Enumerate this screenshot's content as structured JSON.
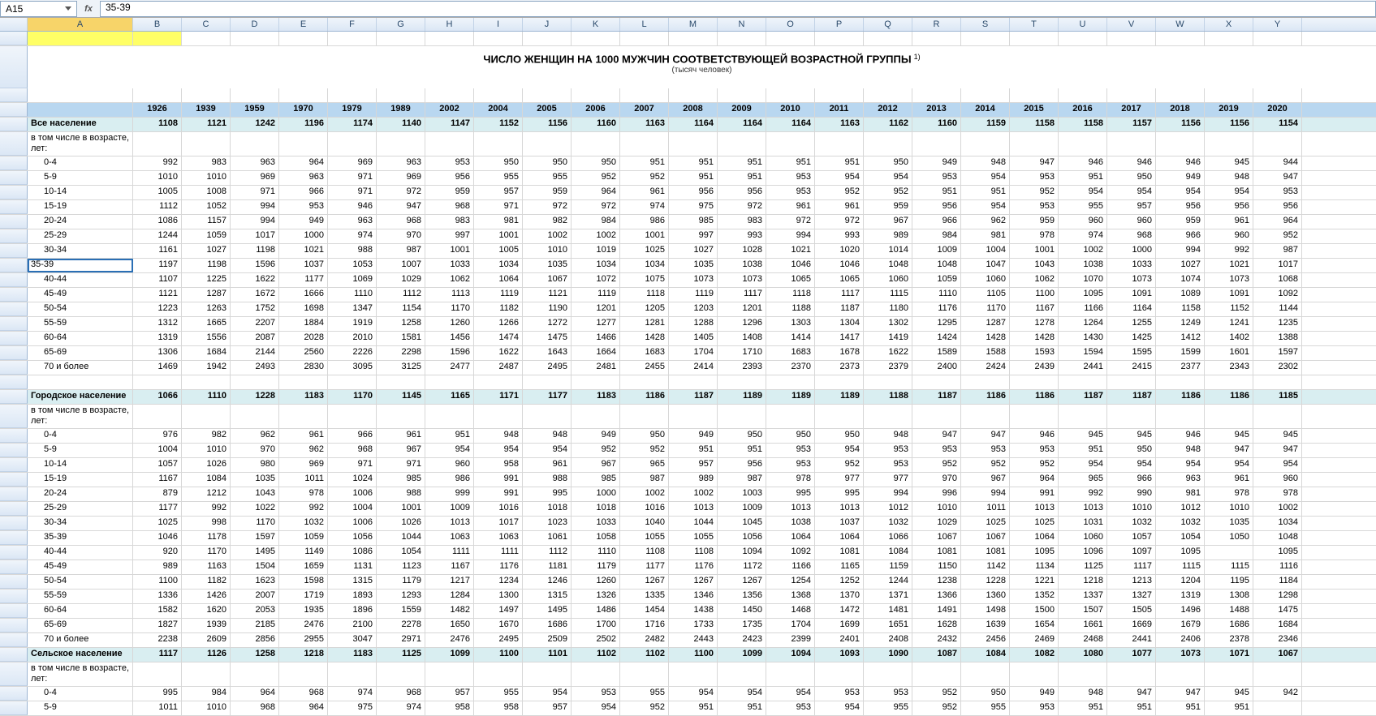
{
  "cellRef": "A15",
  "fxLabel": "fx",
  "formulaValue": "35-39",
  "columns": [
    "A",
    "B",
    "C",
    "D",
    "E",
    "F",
    "G",
    "H",
    "I",
    "J",
    "K",
    "L",
    "M",
    "N",
    "O",
    "P",
    "Q",
    "R",
    "S",
    "T",
    "U",
    "V",
    "W",
    "X",
    "Y"
  ],
  "titleMain": "ЧИСЛО ЖЕНЩИН НА 1000 МУЖЧИН СООТВЕТСТВУЮЩЕЙ ВОЗРАСТНОЙ ГРУППЫ",
  "titleSup": "1)",
  "titleSub": "(тысяч человек)",
  "yearHeader": [
    "",
    "1926",
    "1939",
    "1959",
    "1970",
    "1979",
    "1989",
    "2002",
    "2004",
    "2005",
    "2006",
    "2007",
    "2008",
    "2009",
    "2010",
    "2011",
    "2012",
    "2013",
    "2014",
    "2015",
    "2016",
    "2017",
    "2018",
    "2019",
    "2020"
  ],
  "blocks": [
    {
      "type": "section",
      "header": [
        "Все население",
        "1108",
        "1121",
        "1242",
        "1196",
        "1174",
        "1140",
        "1147",
        "1152",
        "1156",
        "1160",
        "1163",
        "1164",
        "1164",
        "1164",
        "1163",
        "1162",
        "1160",
        "1159",
        "1158",
        "1158",
        "1157",
        "1156",
        "1156",
        "1154"
      ],
      "subLabel": "в том числе в возрасте, лет:",
      "rows": [
        [
          "0-4",
          "992",
          "983",
          "963",
          "964",
          "969",
          "963",
          "953",
          "950",
          "950",
          "950",
          "951",
          "951",
          "951",
          "951",
          "951",
          "950",
          "949",
          "948",
          "947",
          "946",
          "946",
          "946",
          "945",
          "944"
        ],
        [
          "5-9",
          "1010",
          "1010",
          "969",
          "963",
          "971",
          "969",
          "956",
          "955",
          "955",
          "952",
          "952",
          "951",
          "951",
          "953",
          "954",
          "954",
          "953",
          "954",
          "953",
          "951",
          "950",
          "949",
          "948",
          "947"
        ],
        [
          "10-14",
          "1005",
          "1008",
          "971",
          "966",
          "971",
          "972",
          "959",
          "957",
          "959",
          "964",
          "961",
          "956",
          "956",
          "953",
          "952",
          "952",
          "951",
          "951",
          "952",
          "954",
          "954",
          "954",
          "954",
          "953"
        ],
        [
          "15-19",
          "1112",
          "1052",
          "994",
          "953",
          "946",
          "947",
          "968",
          "971",
          "972",
          "972",
          "974",
          "975",
          "972",
          "961",
          "961",
          "959",
          "956",
          "954",
          "953",
          "955",
          "957",
          "956",
          "956",
          "956"
        ],
        [
          "20-24",
          "1086",
          "1157",
          "994",
          "949",
          "963",
          "968",
          "983",
          "981",
          "982",
          "984",
          "986",
          "985",
          "983",
          "972",
          "972",
          "967",
          "966",
          "962",
          "959",
          "960",
          "960",
          "959",
          "961",
          "964"
        ],
        [
          "25-29",
          "1244",
          "1059",
          "1017",
          "1000",
          "974",
          "970",
          "997",
          "1001",
          "1002",
          "1002",
          "1001",
          "997",
          "993",
          "994",
          "993",
          "989",
          "984",
          "981",
          "978",
          "974",
          "968",
          "966",
          "960",
          "952"
        ],
        [
          "30-34",
          "1161",
          "1027",
          "1198",
          "1021",
          "988",
          "987",
          "1001",
          "1005",
          "1010",
          "1019",
          "1025",
          "1027",
          "1028",
          "1021",
          "1020",
          "1014",
          "1009",
          "1004",
          "1001",
          "1002",
          "1000",
          "994",
          "992",
          "987"
        ],
        [
          "35-39",
          "1197",
          "1198",
          "1596",
          "1037",
          "1053",
          "1007",
          "1033",
          "1034",
          "1035",
          "1034",
          "1034",
          "1035",
          "1038",
          "1046",
          "1046",
          "1048",
          "1048",
          "1047",
          "1043",
          "1038",
          "1033",
          "1027",
          "1021",
          "1017"
        ],
        [
          "40-44",
          "1107",
          "1225",
          "1622",
          "1177",
          "1069",
          "1029",
          "1062",
          "1064",
          "1067",
          "1072",
          "1075",
          "1073",
          "1073",
          "1065",
          "1065",
          "1060",
          "1059",
          "1060",
          "1062",
          "1070",
          "1073",
          "1074",
          "1073",
          "1068"
        ],
        [
          "45-49",
          "1121",
          "1287",
          "1672",
          "1666",
          "1110",
          "1112",
          "1113",
          "1119",
          "1121",
          "1119",
          "1118",
          "1119",
          "1117",
          "1118",
          "1117",
          "1115",
          "1110",
          "1105",
          "1100",
          "1095",
          "1091",
          "1089",
          "1091",
          "1092"
        ],
        [
          "50-54",
          "1223",
          "1263",
          "1752",
          "1698",
          "1347",
          "1154",
          "1170",
          "1182",
          "1190",
          "1201",
          "1205",
          "1203",
          "1201",
          "1188",
          "1187",
          "1180",
          "1176",
          "1170",
          "1167",
          "1166",
          "1164",
          "1158",
          "1152",
          "1144"
        ],
        [
          "55-59",
          "1312",
          "1665",
          "2207",
          "1884",
          "1919",
          "1258",
          "1260",
          "1266",
          "1272",
          "1277",
          "1281",
          "1288",
          "1296",
          "1303",
          "1304",
          "1302",
          "1295",
          "1287",
          "1278",
          "1264",
          "1255",
          "1249",
          "1241",
          "1235"
        ],
        [
          "60-64",
          "1319",
          "1556",
          "2087",
          "2028",
          "2010",
          "1581",
          "1456",
          "1474",
          "1475",
          "1466",
          "1428",
          "1405",
          "1408",
          "1414",
          "1417",
          "1419",
          "1424",
          "1428",
          "1428",
          "1430",
          "1425",
          "1412",
          "1402",
          "1388"
        ],
        [
          "65-69",
          "1306",
          "1684",
          "2144",
          "2560",
          "2226",
          "2298",
          "1596",
          "1622",
          "1643",
          "1664",
          "1683",
          "1704",
          "1710",
          "1683",
          "1678",
          "1622",
          "1589",
          "1588",
          "1593",
          "1594",
          "1595",
          "1599",
          "1601",
          "1597"
        ],
        [
          "70 и более",
          "1469",
          "1942",
          "2493",
          "2830",
          "3095",
          "3125",
          "2477",
          "2487",
          "2495",
          "2481",
          "2455",
          "2414",
          "2393",
          "2370",
          "2373",
          "2379",
          "2400",
          "2424",
          "2439",
          "2441",
          "2415",
          "2377",
          "2343",
          "2302"
        ]
      ]
    },
    {
      "type": "section",
      "header": [
        "Городское население",
        "1066",
        "1110",
        "1228",
        "1183",
        "1170",
        "1145",
        "1165",
        "1171",
        "1177",
        "1183",
        "1186",
        "1187",
        "1189",
        "1189",
        "1189",
        "1188",
        "1187",
        "1186",
        "1186",
        "1187",
        "1187",
        "1186",
        "1186",
        "1185"
      ],
      "subLabel": "в том числе в возрасте, лет:",
      "rows": [
        [
          "0-4",
          "976",
          "982",
          "962",
          "961",
          "966",
          "961",
          "951",
          "948",
          "948",
          "949",
          "950",
          "949",
          "950",
          "950",
          "950",
          "948",
          "947",
          "947",
          "946",
          "945",
          "945",
          "946",
          "945",
          "945"
        ],
        [
          "5-9",
          "1004",
          "1010",
          "970",
          "962",
          "968",
          "967",
          "954",
          "954",
          "954",
          "952",
          "952",
          "951",
          "951",
          "953",
          "954",
          "953",
          "953",
          "953",
          "953",
          "951",
          "950",
          "948",
          "947",
          "947"
        ],
        [
          "10-14",
          "1057",
          "1026",
          "980",
          "969",
          "971",
          "971",
          "960",
          "958",
          "961",
          "967",
          "965",
          "957",
          "956",
          "953",
          "952",
          "953",
          "952",
          "952",
          "952",
          "954",
          "954",
          "954",
          "954",
          "954"
        ],
        [
          "15-19",
          "1167",
          "1084",
          "1035",
          "1011",
          "1024",
          "985",
          "986",
          "991",
          "988",
          "985",
          "987",
          "989",
          "987",
          "978",
          "977",
          "977",
          "970",
          "967",
          "964",
          "965",
          "966",
          "963",
          "961",
          "960"
        ],
        [
          "20-24",
          "879",
          "1212",
          "1043",
          "978",
          "1006",
          "988",
          "999",
          "991",
          "995",
          "1000",
          "1002",
          "1002",
          "1003",
          "995",
          "995",
          "994",
          "996",
          "994",
          "991",
          "992",
          "990",
          "981",
          "978",
          "978"
        ],
        [
          "25-29",
          "1177",
          "992",
          "1022",
          "992",
          "1004",
          "1001",
          "1009",
          "1016",
          "1018",
          "1018",
          "1016",
          "1013",
          "1009",
          "1013",
          "1013",
          "1012",
          "1010",
          "1011",
          "1013",
          "1013",
          "1010",
          "1012",
          "1010",
          "1002"
        ],
        [
          "30-34",
          "1025",
          "998",
          "1170",
          "1032",
          "1006",
          "1026",
          "1013",
          "1017",
          "1023",
          "1033",
          "1040",
          "1044",
          "1045",
          "1038",
          "1037",
          "1032",
          "1029",
          "1025",
          "1025",
          "1031",
          "1032",
          "1032",
          "1035",
          "1034"
        ],
        [
          "35-39",
          "1046",
          "1178",
          "1597",
          "1059",
          "1056",
          "1044",
          "1063",
          "1063",
          "1061",
          "1058",
          "1055",
          "1055",
          "1056",
          "1064",
          "1064",
          "1066",
          "1067",
          "1067",
          "1064",
          "1060",
          "1057",
          "1054",
          "1050",
          "1048"
        ],
        [
          "40-44",
          "920",
          "1170",
          "1495",
          "1149",
          "1086",
          "1054",
          "1111",
          "1111",
          "1112",
          "1110",
          "1108",
          "1108",
          "1094",
          "1092",
          "1081",
          "1084",
          "1081",
          "1081",
          "1095",
          "1096",
          "1097",
          "1095",
          "",
          "1095"
        ],
        [
          "45-49",
          "989",
          "1163",
          "1504",
          "1659",
          "1131",
          "1123",
          "1167",
          "1176",
          "1181",
          "1179",
          "1177",
          "1176",
          "1172",
          "1166",
          "1165",
          "1159",
          "1150",
          "1142",
          "1134",
          "1125",
          "1117",
          "1115",
          "1115",
          "1116"
        ],
        [
          "50-54",
          "1100",
          "1182",
          "1623",
          "1598",
          "1315",
          "1179",
          "1217",
          "1234",
          "1246",
          "1260",
          "1267",
          "1267",
          "1267",
          "1254",
          "1252",
          "1244",
          "1238",
          "1228",
          "1221",
          "1218",
          "1213",
          "1204",
          "1195",
          "1184"
        ],
        [
          "55-59",
          "1336",
          "1426",
          "2007",
          "1719",
          "1893",
          "1293",
          "1284",
          "1300",
          "1315",
          "1326",
          "1335",
          "1346",
          "1356",
          "1368",
          "1370",
          "1371",
          "1366",
          "1360",
          "1352",
          "1337",
          "1327",
          "1319",
          "1308",
          "1298"
        ],
        [
          "60-64",
          "1582",
          "1620",
          "2053",
          "1935",
          "1896",
          "1559",
          "1482",
          "1497",
          "1495",
          "1486",
          "1454",
          "1438",
          "1450",
          "1468",
          "1472",
          "1481",
          "1491",
          "1498",
          "1500",
          "1507",
          "1505",
          "1496",
          "1488",
          "1475"
        ],
        [
          "65-69",
          "1827",
          "1939",
          "2185",
          "2476",
          "2100",
          "2278",
          "1650",
          "1670",
          "1686",
          "1700",
          "1716",
          "1733",
          "1735",
          "1704",
          "1699",
          "1651",
          "1628",
          "1639",
          "1654",
          "1661",
          "1669",
          "1679",
          "1686",
          "1684"
        ],
        [
          "70 и более",
          "2238",
          "2609",
          "2856",
          "2955",
          "3047",
          "2971",
          "2476",
          "2495",
          "2509",
          "2502",
          "2482",
          "2443",
          "2423",
          "2399",
          "2401",
          "2408",
          "2432",
          "2456",
          "2469",
          "2468",
          "2441",
          "2406",
          "2378",
          "2346"
        ]
      ]
    },
    {
      "type": "sectionShort",
      "header": [
        "Сельское население",
        "1117",
        "1126",
        "1258",
        "1218",
        "1183",
        "1125",
        "1099",
        "1100",
        "1101",
        "1102",
        "1102",
        "1100",
        "1099",
        "1094",
        "1093",
        "1090",
        "1087",
        "1084",
        "1082",
        "1080",
        "1077",
        "1073",
        "1071",
        "1067"
      ],
      "subLabel": "в том числе в возрасте, лет:",
      "rows": [
        [
          "0-4",
          "995",
          "984",
          "964",
          "968",
          "974",
          "968",
          "957",
          "955",
          "954",
          "953",
          "955",
          "954",
          "954",
          "954",
          "953",
          "953",
          "952",
          "950",
          "949",
          "948",
          "947",
          "947",
          "945",
          "942"
        ],
        [
          "5-9",
          "1011",
          "1010",
          "968",
          "964",
          "975",
          "974",
          "958",
          "958",
          "957",
          "954",
          "952",
          "951",
          "951",
          "953",
          "954",
          "955",
          "952",
          "955",
          "953",
          "951",
          "951",
          "951",
          "951",
          ""
        ]
      ]
    }
  ]
}
